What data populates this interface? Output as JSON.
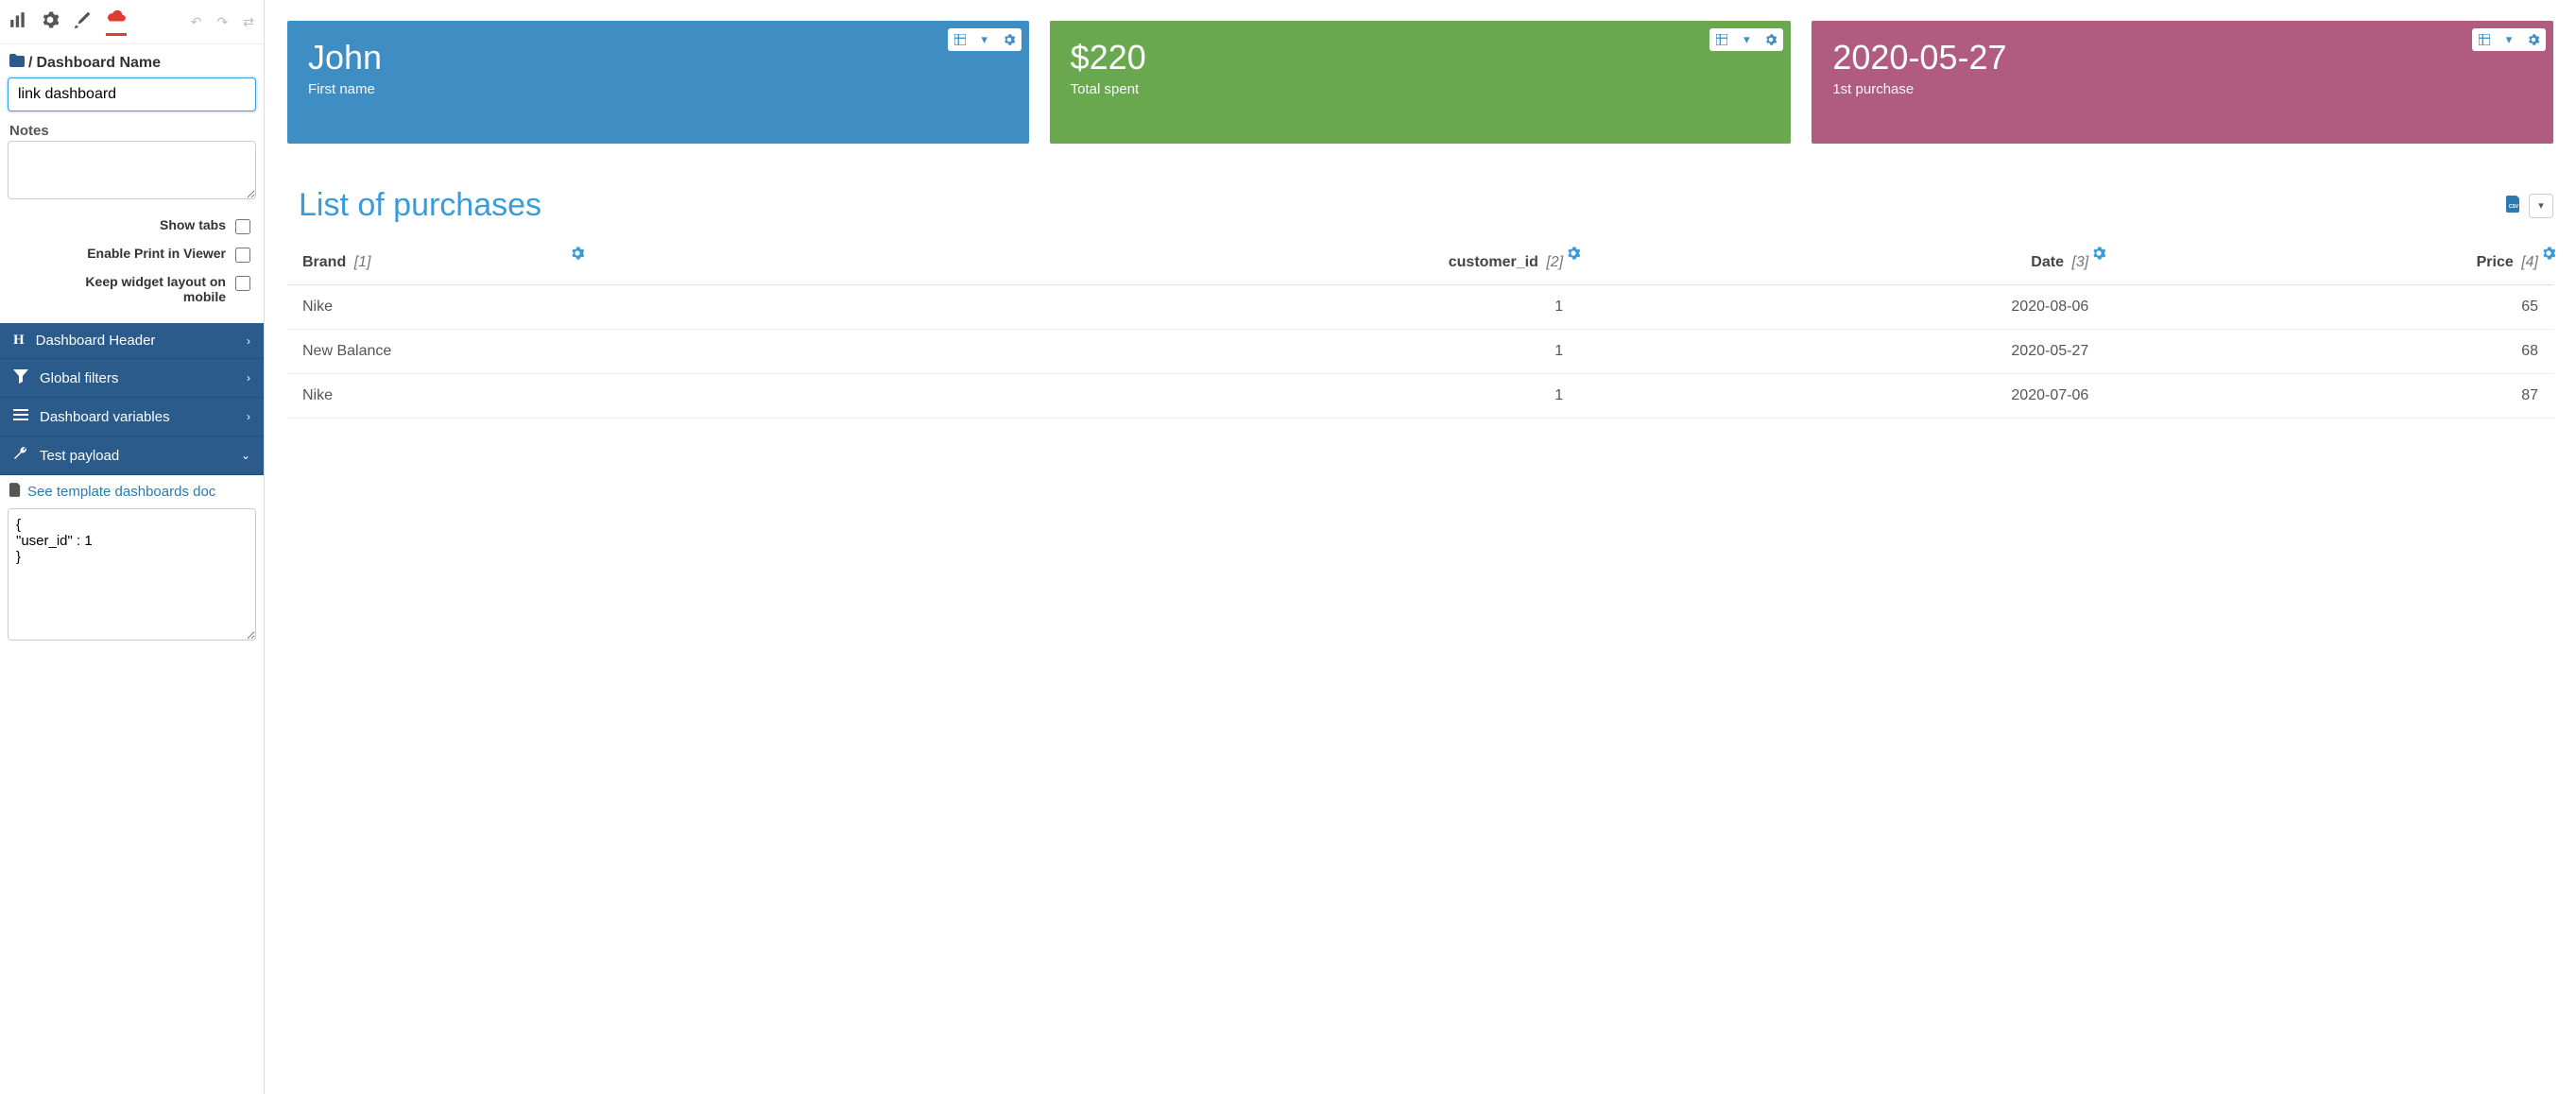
{
  "sidebar": {
    "breadcrumb_label": "Dashboard Name",
    "name_input_value": "link dashboard",
    "notes_label": "Notes",
    "notes_value": "",
    "toggles": {
      "show_tabs": "Show tabs",
      "enable_print": "Enable Print in Viewer",
      "keep_layout": "Keep widget layout on mobile"
    },
    "accordion": {
      "header": "Dashboard Header",
      "filters": "Global filters",
      "variables": "Dashboard variables",
      "payload": "Test payload"
    },
    "doc_link": "See template dashboards doc",
    "payload_text": "{\n\"user_id\" : 1\n}"
  },
  "cards": [
    {
      "value": "John",
      "label": "First name",
      "color": "blue"
    },
    {
      "value": "$220",
      "label": "Total spent",
      "color": "green"
    },
    {
      "value": "2020-05-27",
      "label": "1st purchase",
      "color": "purple"
    }
  ],
  "table": {
    "title": "List of purchases",
    "columns": [
      {
        "label": "Brand",
        "idx": "[1]",
        "align": "left"
      },
      {
        "label": "customer_id",
        "idx": "[2]",
        "align": "right"
      },
      {
        "label": "Date",
        "idx": "[3]",
        "align": "right"
      },
      {
        "label": "Price",
        "idx": "[4]",
        "align": "right"
      }
    ],
    "rows": [
      {
        "brand": "Nike",
        "customer_id": "1",
        "date": "2020-08-06",
        "price": "65"
      },
      {
        "brand": "New Balance",
        "customer_id": "1",
        "date": "2020-05-27",
        "price": "68"
      },
      {
        "brand": "Nike",
        "customer_id": "1",
        "date": "2020-07-06",
        "price": "87"
      }
    ]
  }
}
